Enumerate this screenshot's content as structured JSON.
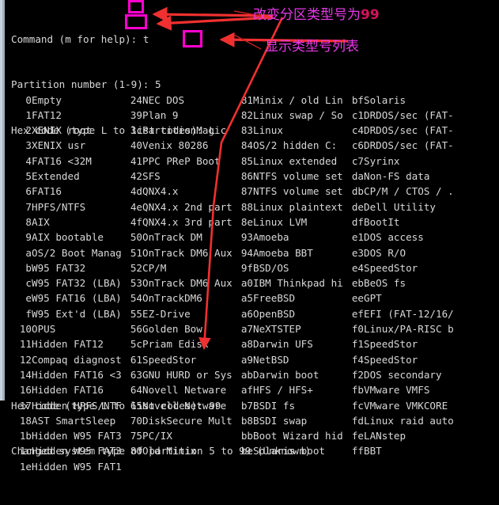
{
  "window": {
    "title": "fdisk terminal session",
    "background_color": "#000000",
    "text_color": "#d8d8d8",
    "highlight_color": "#ff00d0",
    "arrow_color": "#f03030",
    "annotation_color": "#e838e8",
    "annotation_accent_color": "#d4125a"
  },
  "prompt": {
    "lines": [
      {
        "label": "Command (m for help): ",
        "value": "t"
      },
      {
        "label": "Partition number (1-9): ",
        "value": "5"
      },
      {
        "label": "Hex code (type L to list codes): ",
        "value": "L"
      }
    ]
  },
  "annotations": [
    {
      "id": "note-change-type",
      "text_before": "改变分区类型号为",
      "accent": "99"
    },
    {
      "id": "note-list-types",
      "text_before": "显示类型号列表",
      "accent": ""
    }
  ],
  "type_table": {
    "columns": [
      [
        [
          "0",
          "Empty"
        ],
        [
          "1",
          "FAT12"
        ],
        [
          "2",
          "XENIX root"
        ],
        [
          "3",
          "XENIX usr"
        ],
        [
          "4",
          "FAT16 <32M"
        ],
        [
          "5",
          "Extended"
        ],
        [
          "6",
          "FAT16"
        ],
        [
          "7",
          "HPFS/NTFS"
        ],
        [
          "8",
          "AIX"
        ],
        [
          "9",
          "AIX bootable"
        ],
        [
          "a",
          "OS/2 Boot Manag"
        ],
        [
          "b",
          "W95 FAT32"
        ],
        [
          "c",
          "W95 FAT32 (LBA)"
        ],
        [
          "e",
          "W95 FAT16 (LBA)"
        ],
        [
          "f",
          "W95 Ext'd (LBA)"
        ],
        [
          "10",
          "OPUS"
        ],
        [
          "11",
          "Hidden FAT12"
        ],
        [
          "12",
          "Compaq diagnost"
        ],
        [
          "14",
          "Hidden FAT16 <3"
        ],
        [
          "16",
          "Hidden FAT16"
        ],
        [
          "17",
          "Hidden HPFS/NTF"
        ],
        [
          "18",
          "AST SmartSleep"
        ],
        [
          "1b",
          "Hidden W95 FAT3"
        ],
        [
          "1c",
          "Hidden W95 FAT3"
        ],
        [
          "1e",
          "Hidden W95 FAT1"
        ]
      ],
      [
        [
          "24",
          "NEC DOS"
        ],
        [
          "39",
          "Plan 9"
        ],
        [
          "3c",
          "PartitionMagic"
        ],
        [
          "40",
          "Venix 80286"
        ],
        [
          "41",
          "PPC PReP Boot"
        ],
        [
          "42",
          "SFS"
        ],
        [
          "4d",
          "QNX4.x"
        ],
        [
          "4e",
          "QNX4.x 2nd part"
        ],
        [
          "4f",
          "QNX4.x 3rd part"
        ],
        [
          "50",
          "OnTrack DM"
        ],
        [
          "51",
          "OnTrack DM6 Aux"
        ],
        [
          "52",
          "CP/M"
        ],
        [
          "53",
          "OnTrack DM6 Aux"
        ],
        [
          "54",
          "OnTrackDM6"
        ],
        [
          "55",
          "EZ-Drive"
        ],
        [
          "56",
          "Golden Bow"
        ],
        [
          "5c",
          "Priam Edisk"
        ],
        [
          "61",
          "SpeedStor"
        ],
        [
          "63",
          "GNU HURD or Sys"
        ],
        [
          "64",
          "Novell Netware"
        ],
        [
          "65",
          "Novell Netware"
        ],
        [
          "70",
          "DiskSecure Mult"
        ],
        [
          "75",
          "PC/IX"
        ],
        [
          "80",
          "Old Minix"
        ],
        [
          "",
          ""
        ]
      ],
      [
        [
          "81",
          "Minix / old Lin"
        ],
        [
          "82",
          "Linux swap / So"
        ],
        [
          "83",
          "Linux"
        ],
        [
          "84",
          "OS/2 hidden C:"
        ],
        [
          "85",
          "Linux extended"
        ],
        [
          "86",
          "NTFS volume set"
        ],
        [
          "87",
          "NTFS volume set"
        ],
        [
          "88",
          "Linux plaintext"
        ],
        [
          "8e",
          "Linux LVM"
        ],
        [
          "93",
          "Amoeba"
        ],
        [
          "94",
          "Amoeba BBT"
        ],
        [
          "9f",
          "BSD/OS"
        ],
        [
          "a0",
          "IBM Thinkpad hi"
        ],
        [
          "a5",
          "FreeBSD"
        ],
        [
          "a6",
          "OpenBSD"
        ],
        [
          "a7",
          "NeXTSTEP"
        ],
        [
          "a8",
          "Darwin UFS"
        ],
        [
          "a9",
          "NetBSD"
        ],
        [
          "ab",
          "Darwin boot"
        ],
        [
          "af",
          "HFS / HFS+"
        ],
        [
          "b7",
          "BSDI fs"
        ],
        [
          "b8",
          "BSDI swap"
        ],
        [
          "bb",
          "Boot Wizard hid"
        ],
        [
          "be",
          "Solaris boot"
        ],
        [
          "",
          ""
        ]
      ],
      [
        [
          "bf",
          "Solaris"
        ],
        [
          "c1",
          "DRDOS/sec (FAT-"
        ],
        [
          "c4",
          "DRDOS/sec (FAT-"
        ],
        [
          "c6",
          "DRDOS/sec (FAT-"
        ],
        [
          "c7",
          "Syrinx"
        ],
        [
          "da",
          "Non-FS data"
        ],
        [
          "db",
          "CP/M / CTOS / ."
        ],
        [
          "de",
          "Dell Utility"
        ],
        [
          "df",
          "BootIt"
        ],
        [
          "e1",
          "DOS access"
        ],
        [
          "e3",
          "DOS R/O"
        ],
        [
          "e4",
          "SpeedStor"
        ],
        [
          "eb",
          "BeOS fs"
        ],
        [
          "ee",
          "GPT"
        ],
        [
          "ef",
          "EFI (FAT-12/16/"
        ],
        [
          "f0",
          "Linux/PA-RISC b"
        ],
        [
          "f1",
          "SpeedStor"
        ],
        [
          "f4",
          "SpeedStor"
        ],
        [
          "f2",
          "DOS secondary"
        ],
        [
          "fb",
          "VMware VMFS"
        ],
        [
          "fc",
          "VMware VMKCORE"
        ],
        [
          "fd",
          "Linux raid auto"
        ],
        [
          "fe",
          "LANstep"
        ],
        [
          "ff",
          "BBT"
        ],
        [
          "",
          ""
        ]
      ]
    ]
  },
  "footer": {
    "lines": [
      {
        "label": "Hex code (type L to list codes): ",
        "value": "99"
      },
      {
        "label": "Changed system type of partition 5 to 99 (Unknown)",
        "value": ""
      }
    ]
  }
}
